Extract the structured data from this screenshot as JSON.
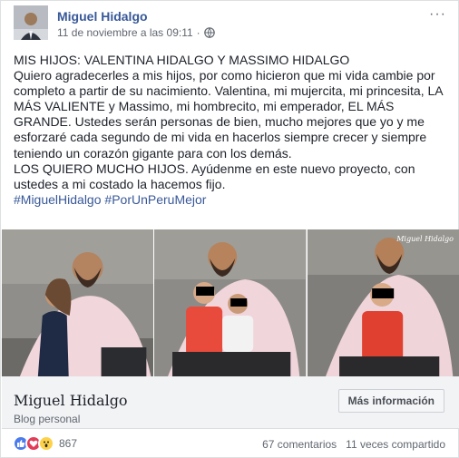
{
  "post": {
    "author": "Miguel Hidalgo",
    "timestamp": "11 de noviembre a las 09:11",
    "separator": "·",
    "privacy_icon": "globe-icon",
    "more_icon": "···",
    "text": {
      "line1": "MIS HIJOS: VALENTINA HIDALGO Y MASSIMO HIDALGO",
      "line2": "Quiero agradecerles a mis hijos, por como hicieron que mi vida cambie por completo a partir de su nacimiento. Valentina, mi mujercita, mi princesita, LA MÁS VALIENTE y Massimo, mi hombrecito, mi emperador, EL MÁS GRANDE. Ustedes serán personas de bien, mucho mejores que yo y me esforzaré cada segundo de mi vida en hacerlos siempre crecer y siempre teniendo un corazón gigante para con los demás.",
      "line3": "LOS QUIERO MUCHO HIJOS. Ayúdenme en este nuevo proyecto, con ustedes a mi costado la hacemos fijo."
    },
    "hashtags": [
      "#MiguelHidalgo",
      "#PorUnPeruMejor"
    ],
    "watermark": "Miguel Hidalgo"
  },
  "card": {
    "title": "Miguel Hidalgo",
    "subtitle": "Blog personal",
    "button": "Más información"
  },
  "footer": {
    "reactions": [
      "like-icon",
      "love-icon",
      "wow-icon"
    ],
    "reaction_count": "867",
    "comments": "67 comentarios",
    "shares": "11 veces compartido"
  },
  "colors": {
    "link": "#385898",
    "text": "#1d2129",
    "meta": "#616770"
  }
}
